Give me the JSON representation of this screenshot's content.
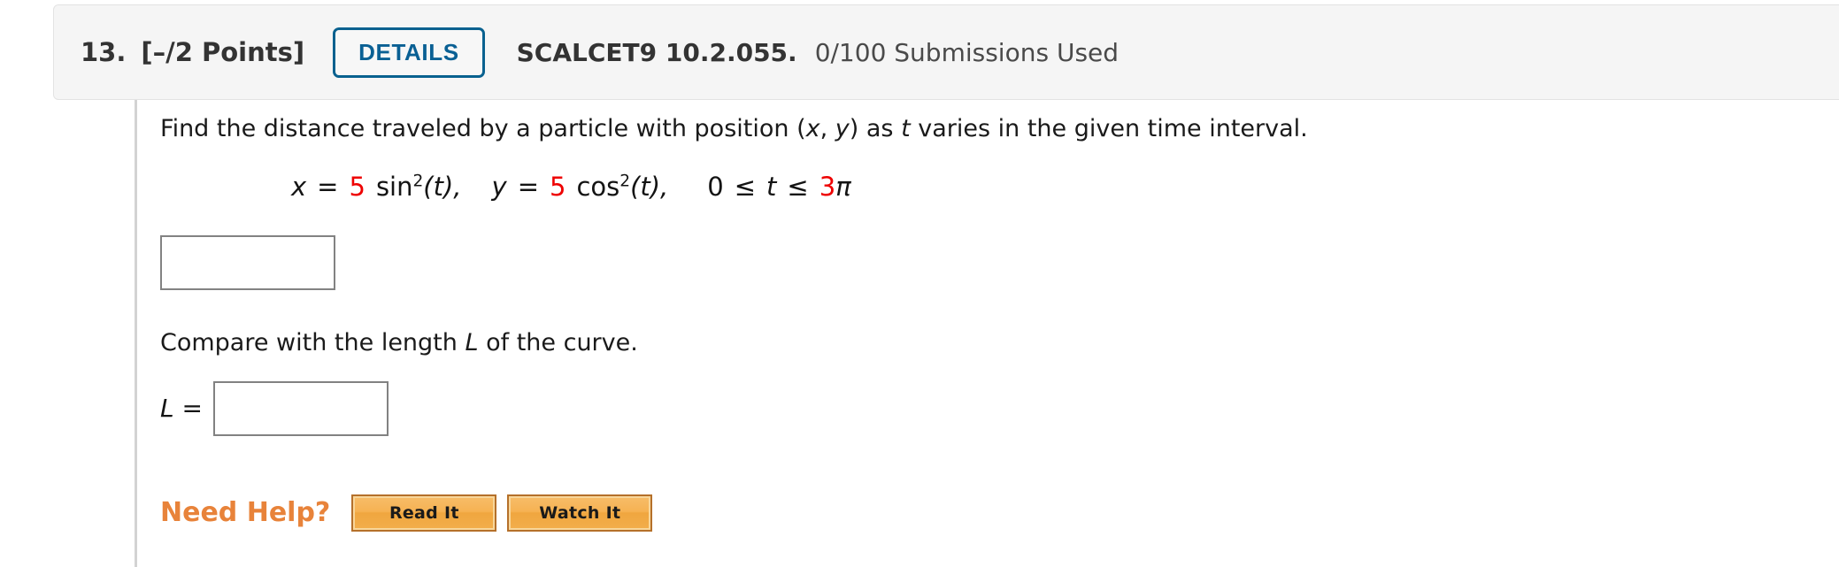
{
  "header": {
    "number": "13.",
    "points": "[–/2 Points]",
    "details_label": "DETAILS",
    "textbook_code": "SCALCET9 10.2.055.",
    "submissions": "0/100 Submissions Used",
    "accent_color": "#0a6094",
    "background_color": "#f5f5f5"
  },
  "question": {
    "prompt_part1": "Find the distance traveled by a particle with position (",
    "prompt_x": "x",
    "prompt_comma": ", ",
    "prompt_y": "y",
    "prompt_part2": ") as ",
    "prompt_t": "t",
    "prompt_part3": " varies in the given time interval.",
    "equation": {
      "x_var": "x",
      "equals": "=",
      "x_coefficient": "5",
      "x_function": "sin",
      "x_power": "2",
      "x_argument": "(t),",
      "y_var": "y",
      "y_coefficient": "5",
      "y_function": "cos",
      "y_power": "2",
      "y_argument": "(t),",
      "interval_lower": "0",
      "interval_le1": "≤",
      "interval_var": "t",
      "interval_le2": "≤",
      "interval_upper_coefficient": "3",
      "interval_upper_symbol": "π",
      "red_color": "#ee0000"
    },
    "distance_answer_value": "",
    "compare_part1": "Compare with the length ",
    "compare_L": "L",
    "compare_part2": " of the curve.",
    "length_label_L": "L",
    "length_label_equals": "=",
    "length_answer_value": ""
  },
  "help": {
    "label": "Need Help?",
    "label_color": "#e8833a",
    "buttons": [
      {
        "label": "Read It",
        "name": "read-it-button"
      },
      {
        "label": "Watch It",
        "name": "watch-it-button"
      }
    ]
  }
}
